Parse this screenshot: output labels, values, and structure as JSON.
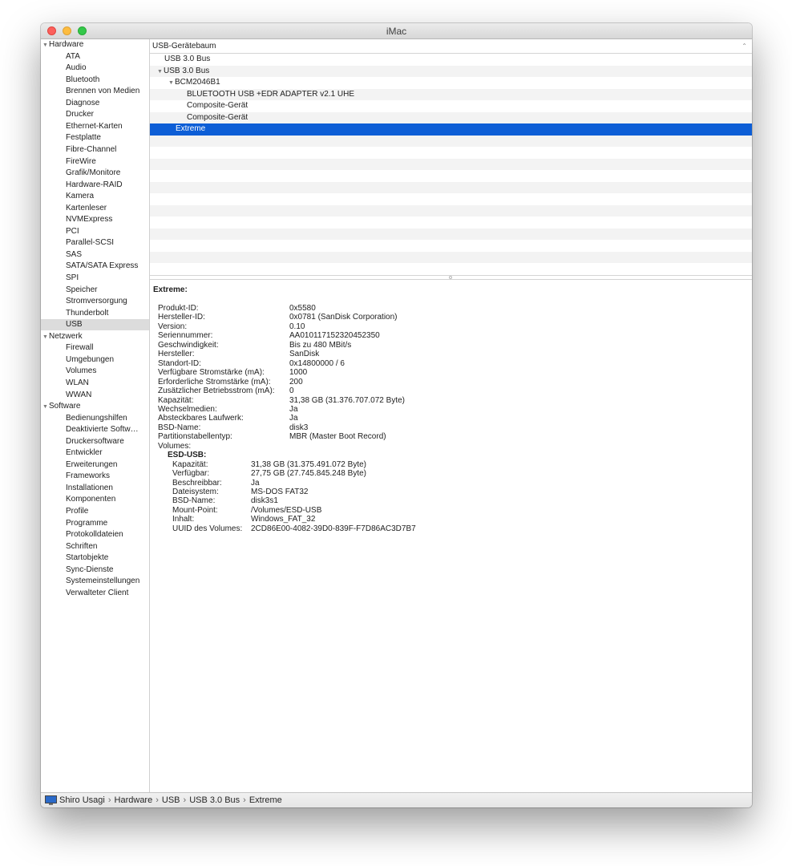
{
  "window": {
    "title": "iMac"
  },
  "sidebar": {
    "sections": [
      {
        "label": "Hardware",
        "items": [
          "ATA",
          "Audio",
          "Bluetooth",
          "Brennen von Medien",
          "Diagnose",
          "Drucker",
          "Ethernet-Karten",
          "Festplatte",
          "Fibre-Channel",
          "FireWire",
          "Grafik/Monitore",
          "Hardware-RAID",
          "Kamera",
          "Kartenleser",
          "NVMExpress",
          "PCI",
          "Parallel-SCSI",
          "SAS",
          "SATA/SATA Express",
          "SPI",
          "Speicher",
          "Stromversorgung",
          "Thunderbolt",
          "USB"
        ]
      },
      {
        "label": "Netzwerk",
        "items": [
          "Firewall",
          "Umgebungen",
          "Volumes",
          "WLAN",
          "WWAN"
        ]
      },
      {
        "label": "Software",
        "items": [
          "Bedienungshilfen",
          "Deaktivierte Softw…",
          "Druckersoftware",
          "Entwickler",
          "Erweiterungen",
          "Frameworks",
          "Installationen",
          "Komponenten",
          "Profile",
          "Programme",
          "Protokolldateien",
          "Schriften",
          "Startobjekte",
          "Sync-Dienste",
          "Systemeinstellungen",
          "Verwalteter Client"
        ]
      }
    ],
    "selected": "USB"
  },
  "tree": {
    "header": "USB-Gerätebaum",
    "rows": [
      {
        "label": "USB 3.0 Bus",
        "level": 0,
        "expandable": false,
        "selected": false
      },
      {
        "label": "USB 3.0 Bus",
        "level": 0,
        "expandable": true,
        "selected": false
      },
      {
        "label": "BCM2046B1",
        "level": 1,
        "expandable": true,
        "selected": false
      },
      {
        "label": "BLUETOOTH USB +EDR ADAPTER v2.1 UHE",
        "level": 2,
        "expandable": false,
        "selected": false
      },
      {
        "label": "Composite-Gerät",
        "level": 2,
        "expandable": false,
        "selected": false
      },
      {
        "label": "Composite-Gerät",
        "level": 2,
        "expandable": false,
        "selected": false
      },
      {
        "label": "Extreme",
        "level": 1,
        "expandable": false,
        "selected": true
      }
    ]
  },
  "details": {
    "title": "Extreme:",
    "properties": [
      {
        "key": "Produkt-ID:",
        "value": "0x5580"
      },
      {
        "key": "Hersteller-ID:",
        "value": "0x0781  (SanDisk Corporation)"
      },
      {
        "key": "Version:",
        "value": "0.10"
      },
      {
        "key": "Seriennummer:",
        "value": "AA010117152320452350"
      },
      {
        "key": "Geschwindigkeit:",
        "value": "Bis zu 480 MBit/s"
      },
      {
        "key": "Hersteller:",
        "value": "SanDisk"
      },
      {
        "key": "Standort-ID:",
        "value": "0x14800000 / 6"
      },
      {
        "key": "Verfügbare Stromstärke (mA):",
        "value": "1000"
      },
      {
        "key": "Erforderliche Stromstärke (mA):",
        "value": "200"
      },
      {
        "key": "Zusätzlicher Betriebsstrom (mA):",
        "value": "0"
      },
      {
        "key": "Kapazität:",
        "value": "31,38 GB (31.376.707.072 Byte)"
      },
      {
        "key": "Wechselmedien:",
        "value": "Ja"
      },
      {
        "key": "Absteckbares Laufwerk:",
        "value": "Ja"
      },
      {
        "key": "BSD-Name:",
        "value": "disk3"
      },
      {
        "key": "Partitionstabellentyp:",
        "value": "MBR (Master Boot Record)"
      },
      {
        "key": "Volumes:",
        "value": ""
      }
    ],
    "volume": {
      "name": "ESD-USB:",
      "properties": [
        {
          "key": "Kapazität:",
          "value": "31,38 GB (31.375.491.072 Byte)"
        },
        {
          "key": "Verfügbar:",
          "value": "27,75 GB (27.745.845.248 Byte)"
        },
        {
          "key": "Beschreibbar:",
          "value": "Ja"
        },
        {
          "key": "Dateisystem:",
          "value": "MS-DOS FAT32"
        },
        {
          "key": "BSD-Name:",
          "value": "disk3s1"
        },
        {
          "key": "Mount-Point:",
          "value": "/Volumes/ESD-USB"
        },
        {
          "key": "Inhalt:",
          "value": "Windows_FAT_32"
        },
        {
          "key": "UUID des Volumes:",
          "value": "2CD86E00-4082-39D0-839F-F7D86AC3D7B7"
        }
      ]
    }
  },
  "statusbar": {
    "icon": "imac-icon",
    "breadcrumb": [
      "Shiro Usagi",
      "Hardware",
      "USB",
      "USB 3.0 Bus",
      "Extreme"
    ],
    "separator": "›"
  },
  "colors": {
    "selection": "#0d5ed6",
    "sidebar_selection": "#dcdcdc",
    "alt_row": "#f3f3f3"
  }
}
